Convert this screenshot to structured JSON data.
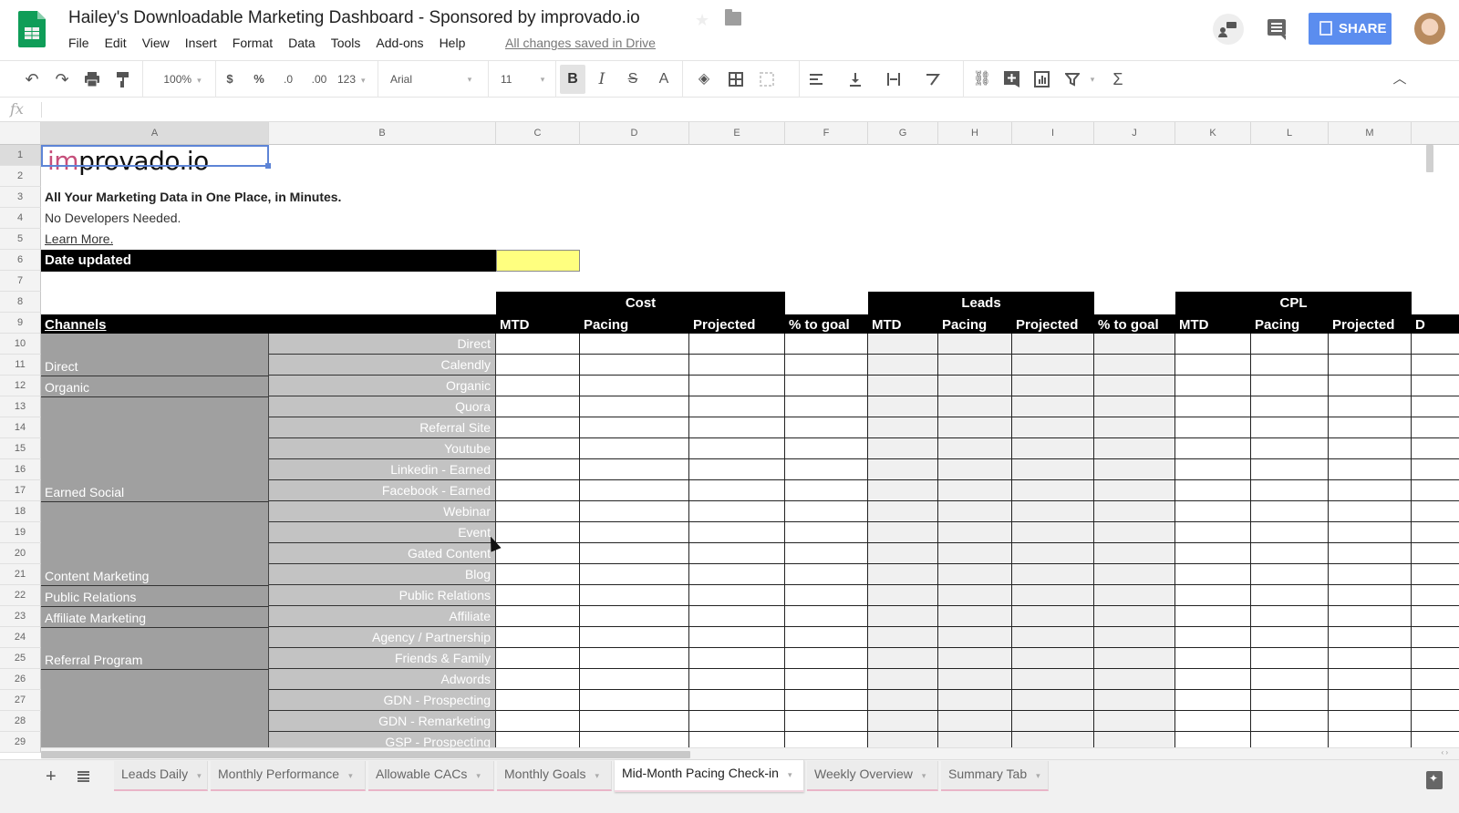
{
  "app": {
    "title": "Hailey's Downloadable Marketing Dashboard - Sponsored by improvado.io",
    "save_status": "All changes saved in Drive",
    "share_label": "SHARE",
    "menu": [
      "File",
      "Edit",
      "View",
      "Insert",
      "Format",
      "Data",
      "Tools",
      "Add-ons",
      "Help"
    ]
  },
  "toolbar": {
    "zoom": "100%",
    "currency": "$",
    "percent": "%",
    "dec_decrease": ".0",
    "dec_increase": ".00",
    "more_formats": "123",
    "font": "Arial",
    "font_size": "11",
    "bold": "B",
    "italic": "I",
    "strike": "S",
    "text_color": "A",
    "sum": "Σ"
  },
  "formula_bar": {
    "fx": "fx",
    "value": ""
  },
  "columns": [
    "A",
    "B",
    "C",
    "D",
    "E",
    "F",
    "G",
    "H",
    "I",
    "J",
    "K",
    "L",
    "M"
  ],
  "rows": [
    "1",
    "2",
    "3",
    "4",
    "5",
    "6",
    "7",
    "8",
    "9",
    "10",
    "11",
    "12",
    "13",
    "14",
    "15",
    "16",
    "17",
    "18",
    "19",
    "20",
    "21",
    "22",
    "23",
    "24",
    "25",
    "26",
    "27",
    "28",
    "29"
  ],
  "sheet": {
    "logo_prefix": "im",
    "logo_suffix": "provado.io",
    "tagline": "All Your Marketing Data in One Place, in Minutes.",
    "subtag": "No Developers Needed.",
    "learn_more": "Learn More.",
    "date_updated_label": "Date updated",
    "date_updated_value": "",
    "date_cell_color": "#ffff7f",
    "channels_header": "Channels",
    "groups": [
      {
        "label": "Cost",
        "subs": [
          "MTD",
          "Pacing",
          "Projected"
        ]
      },
      {
        "label": "Leads",
        "subs": [
          "MTD",
          "Pacing",
          "Projected"
        ]
      },
      {
        "label": "CPL",
        "subs": [
          "MTD",
          "Pacing",
          "Projected"
        ]
      }
    ],
    "pct_to_goal": "% to goal",
    "overflow_header": "D",
    "channels": [
      {
        "name": "Direct",
        "subs": [
          "Direct",
          "Calendly"
        ]
      },
      {
        "name": "Organic",
        "subs": [
          "Organic"
        ]
      },
      {
        "name": "Earned Social",
        "subs": [
          "Quora",
          "Referral Site",
          "Youtube",
          "Linkedin - Earned",
          "Facebook - Earned"
        ]
      },
      {
        "name": "Content Marketing",
        "subs": [
          "Webinar",
          "Event",
          "Gated Content",
          "Blog"
        ]
      },
      {
        "name": "Public Relations",
        "subs": [
          "Public Relations"
        ]
      },
      {
        "name": "Affiliate Marketing",
        "subs": [
          "Affiliate"
        ]
      },
      {
        "name": "Referral Program",
        "subs": [
          "Agency / Partnership",
          "Friends & Family"
        ]
      },
      {
        "name": "",
        "subs": [
          "Adwords",
          "GDN - Prospecting",
          "GDN - Remarketing",
          "GSP - Prospecting"
        ]
      }
    ]
  },
  "tabs": [
    {
      "label": "Leads Daily",
      "active": false
    },
    {
      "label": "Monthly Performance",
      "active": false
    },
    {
      "label": "Allowable CACs",
      "active": false
    },
    {
      "label": "Monthly Goals",
      "active": false
    },
    {
      "label": "Mid-Month Pacing Check-in",
      "active": true
    },
    {
      "label": "Weekly Overview",
      "active": false
    },
    {
      "label": "Summary Tab",
      "active": false
    }
  ]
}
